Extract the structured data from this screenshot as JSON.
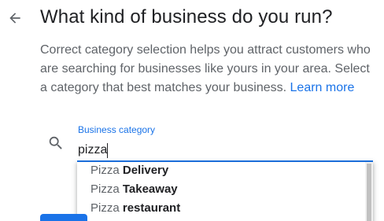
{
  "header": {
    "back_icon": "arrow-back-icon",
    "title": "What kind of business do you run?"
  },
  "description": {
    "text": "Correct category selection helps you attract customers who are searching for businesses like yours in your area. Select a category that best matches your business.",
    "link": "Learn more"
  },
  "search": {
    "icon": "search-icon",
    "label": "Business category",
    "value": "pizza",
    "accent_color": "#1a73e8"
  },
  "suggestions": [
    {
      "match": "Pizza",
      "rest": " Delivery"
    },
    {
      "match": "Pizza",
      "rest": " Takeaway"
    },
    {
      "match": "Pizza",
      "rest": " restaurant"
    }
  ],
  "colors": {
    "primary": "#1a73e8",
    "title": "#202124",
    "body": "#5f6368"
  }
}
